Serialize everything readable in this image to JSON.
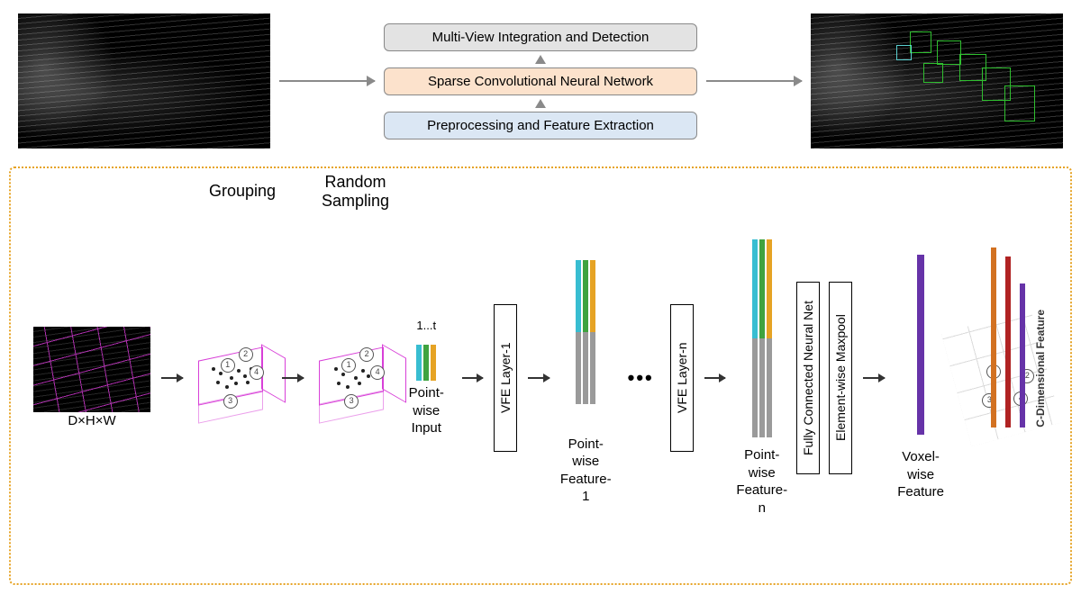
{
  "pipeline": {
    "top": "Multi-View Integration and Detection",
    "mid": "Sparse Convolutional Neural Network",
    "bot": "Preprocessing and Feature Extraction"
  },
  "labels": {
    "dhw": "D×H×W",
    "grouping": "Grouping",
    "sampling": "Random\nSampling",
    "pointwise_input_idx": "1...t",
    "pointwise_input": "Point-wise\nInput",
    "vfe1": "VFE Layer-1",
    "vfen": "VFE Layer-n",
    "pwf1": "Point-wise\nFeature-1",
    "pwfn": "Point-wise\nFeature-n",
    "fcnn": "Fully Connected Neural Net",
    "maxpool": "Element-wise Maxpool",
    "voxelwise": "Voxel-wise\nFeature",
    "cdim": "C-Dimensional Feature"
  },
  "out_circles": [
    "1",
    "2",
    "3",
    "4"
  ]
}
